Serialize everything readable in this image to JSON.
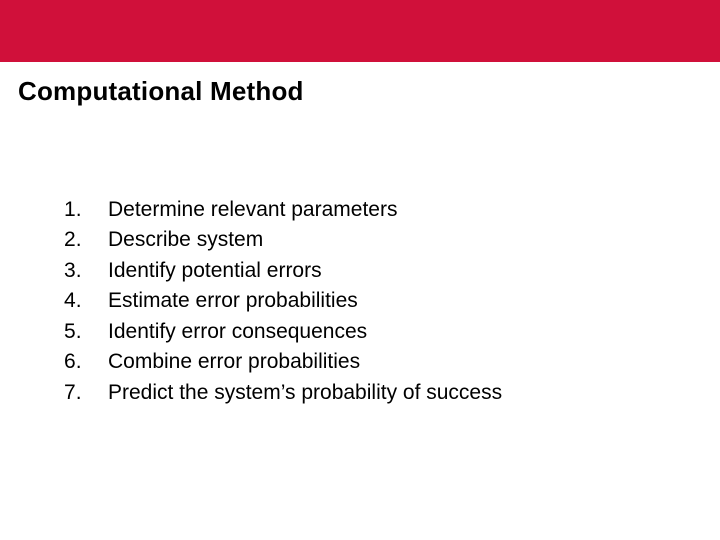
{
  "header": {
    "title": "Computational Method"
  },
  "steps": [
    "Determine relevant parameters",
    "Describe system",
    "Identify potential errors",
    "Estimate error probabilities",
    "Identify error consequences",
    "Combine error probabilities",
    "Predict the system’s probability of success"
  ]
}
